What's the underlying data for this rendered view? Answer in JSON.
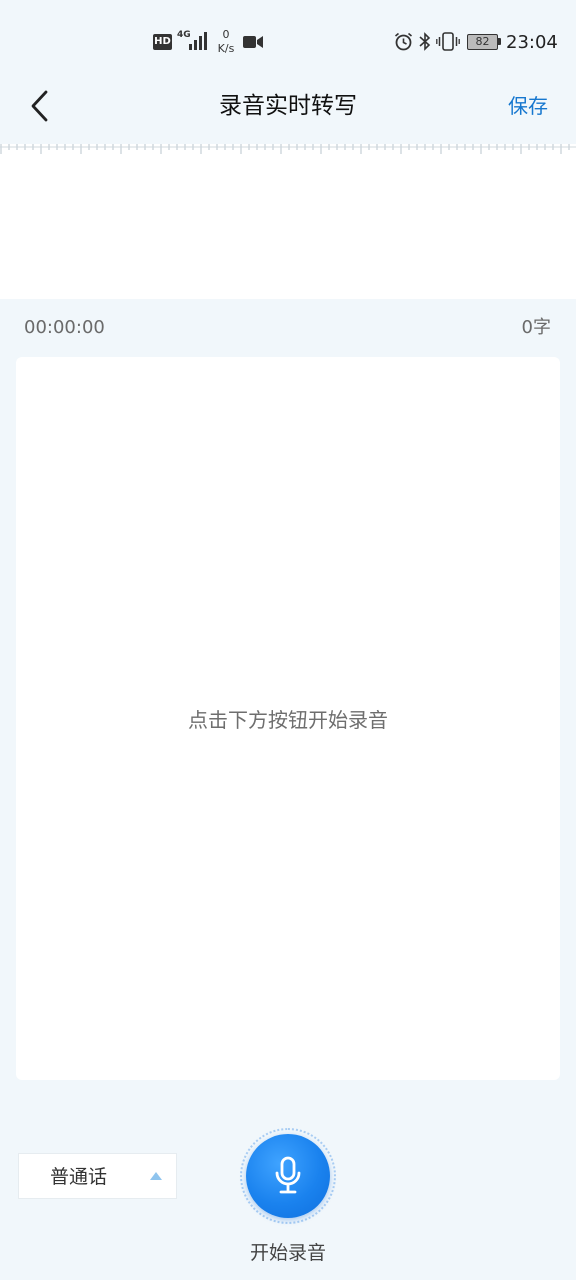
{
  "status_bar": {
    "hd": "HD",
    "network": "4G",
    "net_speed_value": "0",
    "net_speed_unit": "K/s",
    "battery": "82",
    "time": "23:04"
  },
  "header": {
    "back_icon": "chevron-left-icon",
    "title": "录音实时转写",
    "save_label": "保存"
  },
  "recording": {
    "elapsed": "00:00:00",
    "word_count": "0字",
    "hint": "点击下方按钮开始录音"
  },
  "controls": {
    "language": "普通话",
    "language_icon": "triangle-up-icon",
    "record_icon": "microphone-icon",
    "record_label": "开始录音"
  },
  "colors": {
    "accent": "#1677cf",
    "record_button": "#1a82ee",
    "background": "#f1f7fb"
  }
}
